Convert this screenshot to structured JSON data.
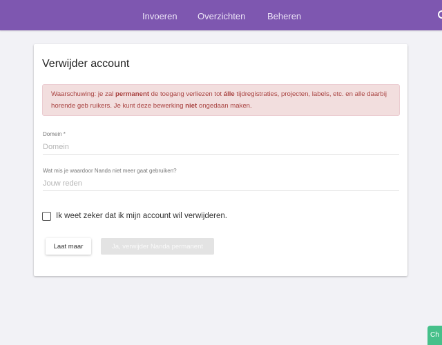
{
  "nav": {
    "items": [
      "Invoeren",
      "Overzichten",
      "Beheren"
    ]
  },
  "card": {
    "title": "Verwijder account",
    "alert": {
      "prefix": "Waarschuwing: je zal ",
      "strong1": "permanent",
      "middle1": " de toegang verliezen tot ",
      "strong2": "álle",
      "middle2": " tijdregistraties, projecten, labels, etc. en alle daarbij horende geb ruikers. Je kunt deze bewerking ",
      "strong3": "niet",
      "suffix": " ongedaan maken."
    },
    "domain_field": {
      "label": "Domein *",
      "placeholder": "Domein",
      "value": ""
    },
    "reason_field": {
      "label": "Wat mis je waardoor Nanda niet meer gaat gebruiken?",
      "placeholder": "Jouw reden",
      "value": ""
    },
    "confirm": {
      "label": "Ik weet zeker dat ik mijn account wil verwijderen.",
      "checked": false
    },
    "buttons": {
      "cancel": "Laat maar",
      "delete": "Ja, verwijder Nanda permanent"
    }
  },
  "chat": {
    "label": "Ch"
  },
  "colors": {
    "header": "#7e57b0",
    "alert_bg": "#f2dede",
    "alert_text": "#a94442",
    "chat": "#46c08a"
  }
}
